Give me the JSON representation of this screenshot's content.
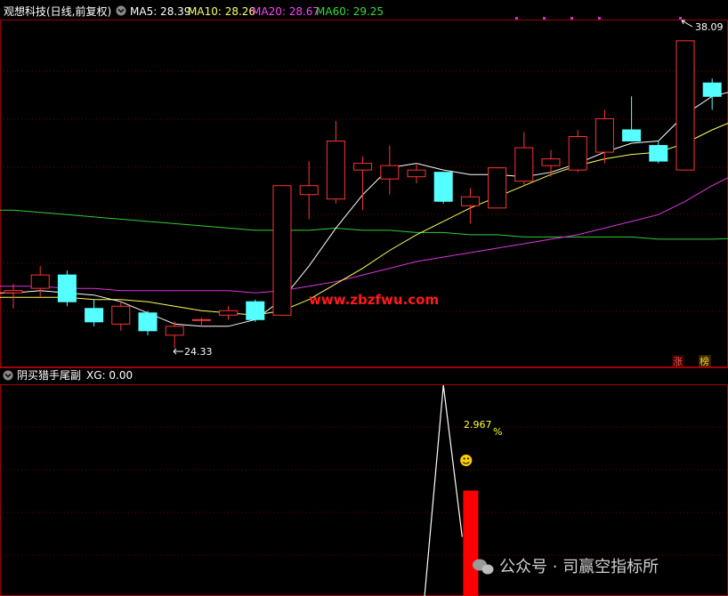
{
  "main_panel": {
    "title": "观想科技(日线,前复权)",
    "ma": [
      {
        "label": "MA5: 28.39",
        "color": "#ffffff"
      },
      {
        "label": "MA10: 28.26",
        "color": "#ffff66"
      },
      {
        "label": "MA20: 28.67",
        "color": "#ff44ff"
      },
      {
        "label": "MA60: 29.25",
        "color": "#33dd33"
      }
    ],
    "high_label": "38.09",
    "low_label": "24.33",
    "watermark": "www.zbzfwu.com",
    "badges": [
      "涨",
      "榜"
    ]
  },
  "sub_panel": {
    "title": "阴买猎手尾副",
    "xg_label": "XG: 0.00",
    "percent_value": "2.967",
    "percent_unit": "%",
    "smiley": "☻"
  },
  "footer_watermark": "公众号 · 司赢空指标所",
  "chart_data": {
    "type": "candlestick",
    "y_range": [
      23.5,
      39.0
    ],
    "high": 38.09,
    "low": 24.33,
    "candles": [
      {
        "o": 26.8,
        "c": 26.9,
        "h": 27.2,
        "l": 26.1
      },
      {
        "o": 27.0,
        "c": 27.6,
        "h": 28.0,
        "l": 26.6
      },
      {
        "o": 27.6,
        "c": 26.4,
        "h": 27.8,
        "l": 26.2
      },
      {
        "o": 26.1,
        "c": 25.5,
        "h": 26.5,
        "l": 25.3
      },
      {
        "o": 25.4,
        "c": 26.2,
        "h": 26.4,
        "l": 25.1
      },
      {
        "o": 25.9,
        "c": 25.1,
        "h": 26.0,
        "l": 24.9
      },
      {
        "o": 24.9,
        "c": 25.3,
        "h": 25.5,
        "l": 24.33
      },
      {
        "o": 25.6,
        "c": 25.6,
        "h": 25.7,
        "l": 25.3
      },
      {
        "o": 25.8,
        "c": 26.0,
        "h": 26.2,
        "l": 25.6
      },
      {
        "o": 26.4,
        "c": 25.6,
        "h": 26.5,
        "l": 25.5
      },
      {
        "o": 25.8,
        "c": 31.6,
        "h": 31.6,
        "l": 25.8
      },
      {
        "o": 31.2,
        "c": 31.6,
        "h": 32.7,
        "l": 30.1
      },
      {
        "o": 31.0,
        "c": 33.6,
        "h": 34.5,
        "l": 30.8
      },
      {
        "o": 32.3,
        "c": 32.6,
        "h": 32.9,
        "l": 30.5
      },
      {
        "o": 31.9,
        "c": 32.5,
        "h": 33.4,
        "l": 31.2
      },
      {
        "o": 32.0,
        "c": 32.3,
        "h": 32.6,
        "l": 31.7
      },
      {
        "o": 32.2,
        "c": 30.9,
        "h": 32.2,
        "l": 30.8
      },
      {
        "o": 30.7,
        "c": 31.1,
        "h": 31.5,
        "l": 29.9
      },
      {
        "o": 30.6,
        "c": 32.4,
        "h": 32.4,
        "l": 30.6
      },
      {
        "o": 31.8,
        "c": 33.3,
        "h": 34.0,
        "l": 31.6
      },
      {
        "o": 32.5,
        "c": 32.8,
        "h": 33.2,
        "l": 32.0
      },
      {
        "o": 32.3,
        "c": 33.8,
        "h": 34.1,
        "l": 32.2
      },
      {
        "o": 33.1,
        "c": 34.6,
        "h": 35.0,
        "l": 32.6
      },
      {
        "o": 34.1,
        "c": 33.6,
        "h": 35.6,
        "l": 33.6
      },
      {
        "o": 33.4,
        "c": 32.7,
        "h": 33.6,
        "l": 32.6
      },
      {
        "o": 32.3,
        "c": 38.09,
        "h": 38.09,
        "l": 32.3
      },
      {
        "o": 36.2,
        "c": 35.6,
        "h": 36.4,
        "l": 35.0
      },
      {
        "o": 35.0,
        "c": 35.3,
        "h": 35.7,
        "l": 34.9
      }
    ],
    "ma5": [
      26.8,
      26.9,
      26.8,
      26.7,
      26.4,
      25.9,
      25.4,
      25.3,
      25.3,
      25.6,
      26.5,
      28.0,
      29.7,
      31.2,
      32.4,
      32.6,
      32.3,
      32.1,
      32.1,
      32.0,
      32.2,
      32.6,
      33.1,
      33.5,
      33.6,
      34.8,
      35.6,
      35.9
    ],
    "ma10": [
      26.6,
      26.6,
      26.6,
      26.5,
      26.5,
      26.4,
      26.2,
      26.0,
      25.9,
      25.8,
      26.0,
      26.5,
      27.2,
      27.9,
      28.7,
      29.4,
      30.0,
      30.6,
      31.1,
      31.6,
      32.1,
      32.5,
      32.8,
      33.0,
      33.1,
      33.5,
      34.1,
      34.6
    ],
    "ma20": [
      27.1,
      27.1,
      27.0,
      27.0,
      26.9,
      26.9,
      26.9,
      26.9,
      26.9,
      26.8,
      26.9,
      27.1,
      27.3,
      27.6,
      27.9,
      28.2,
      28.4,
      28.6,
      28.8,
      29.0,
      29.2,
      29.4,
      29.7,
      30.0,
      30.3,
      30.9,
      31.6,
      32.2
    ],
    "ma60": [
      30.5,
      30.4,
      30.3,
      30.2,
      30.1,
      30.0,
      29.9,
      29.8,
      29.7,
      29.6,
      29.6,
      29.6,
      29.7,
      29.6,
      29.6,
      29.5,
      29.5,
      29.4,
      29.4,
      29.3,
      29.3,
      29.3,
      29.3,
      29.3,
      29.2,
      29.2,
      29.2,
      29.25
    ],
    "indicator": {
      "type": "line",
      "y_range": [
        0,
        100
      ],
      "x": [
        15.3,
        16.0,
        16.7
      ],
      "values": [
        0,
        100,
        28
      ],
      "bar": {
        "x": 17.0,
        "value": 50,
        "color": "#ff0000"
      }
    }
  }
}
